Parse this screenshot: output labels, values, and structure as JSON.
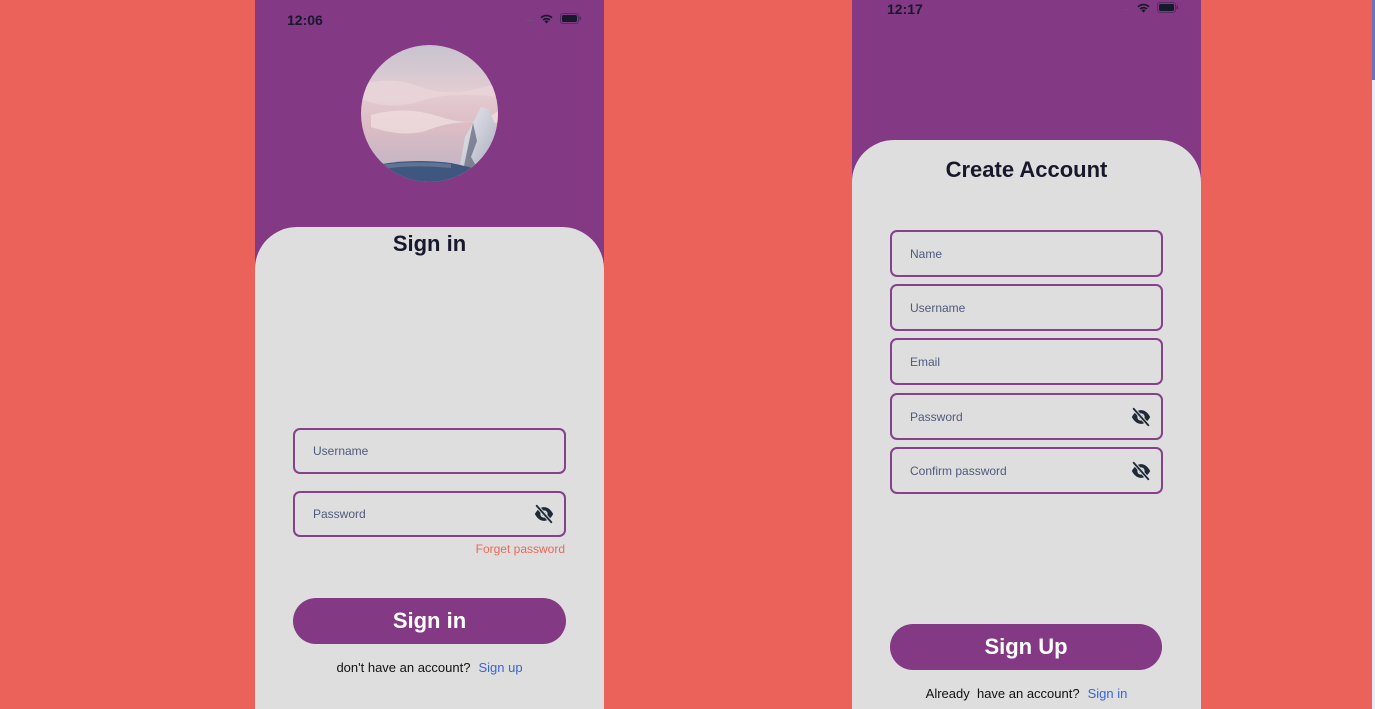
{
  "colors": {
    "background": "#EB625A",
    "header_purple": "#833984",
    "card_gray": "#DEDEDE",
    "field_border": "#86418A",
    "link_blue": "#3a63d6",
    "forget_orange": "#EB6A57"
  },
  "signin_screen": {
    "status_time": "12:06",
    "avatar_icon": "mountain-sky-photo",
    "title": "Sign in",
    "username_placeholder": "Username",
    "password_placeholder": "Password",
    "password_toggle_icon": "eye-off-icon",
    "forget_password": "Forget password",
    "submit_label": "Sign in",
    "footer_text": "don't have an account?",
    "footer_link": "Sign up"
  },
  "signup_screen": {
    "status_time": "12:17",
    "title": "Create Account",
    "name_placeholder": "Name",
    "username_placeholder": "Username",
    "email_placeholder": "Email",
    "password_placeholder": "Password",
    "confirm_placeholder": "Confirm password",
    "password_toggle_icon": "eye-off-icon",
    "submit_label": "Sign Up",
    "footer_text": "Already  have an account?",
    "footer_link": "Sign in"
  }
}
